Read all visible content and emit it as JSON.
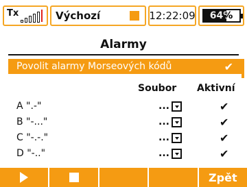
{
  "status_bar": {
    "tx_label": "Tx",
    "tx_signal_bars_filled": 0,
    "model_name": "Výchozí",
    "time": "12:22:09",
    "battery_percent_text": "64%",
    "battery_level": 0.64
  },
  "screen": {
    "title": "Alarmy"
  },
  "morse": {
    "label": "Povolit alarmy Morseových kódů",
    "checked": true,
    "check_glyph": "✔"
  },
  "table": {
    "headers": {
      "soubor": "Soubor",
      "aktivni": "Aktivní"
    },
    "rows": [
      {
        "name": "A \".-\"",
        "file": "...",
        "active": "✔"
      },
      {
        "name": "B \"-...\"",
        "file": "...",
        "active": "✔"
      },
      {
        "name": "C \"-.-.\"",
        "file": "...",
        "active": "✔"
      },
      {
        "name": "D \"-..\"",
        "file": "...",
        "active": "✔"
      }
    ]
  },
  "softkeys": {
    "f1_icon": "play-icon",
    "f2_icon": "stop-icon",
    "f5_label": "Zpět"
  },
  "colors": {
    "accent": "#f59b12",
    "frame_border": "#f5a623",
    "tx_separator": "#e2231a"
  }
}
